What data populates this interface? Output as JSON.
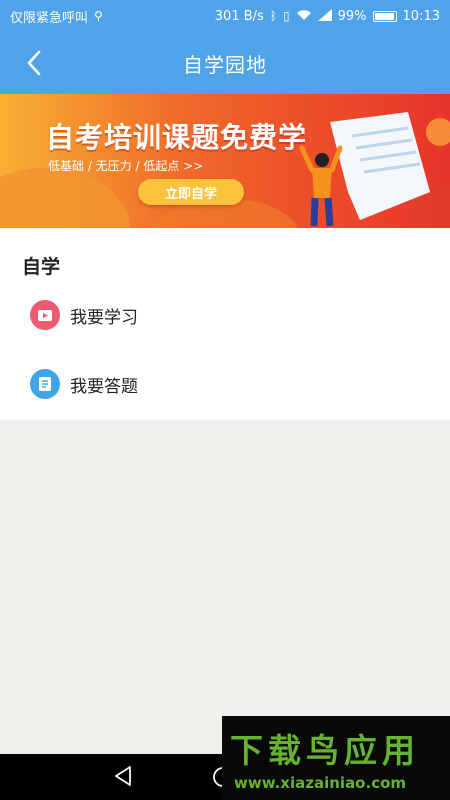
{
  "status_bar": {
    "left_text": "仅限紧急呼叫",
    "usb_icon": "usb-icon",
    "speed": "301 B/s",
    "battery_percent": "99%",
    "time": "10:13"
  },
  "app_bar": {
    "title": "自学园地",
    "back_icon": "chevron-left-icon"
  },
  "banner": {
    "headline": "自考培训课题免费学",
    "subline": "低基础 / 无压力 / 低起点 >>",
    "cta_label": "立即自学"
  },
  "section": {
    "title": "自学",
    "items": [
      {
        "label": "我要学习",
        "icon": "video-play-icon",
        "color": "#ee5a6f"
      },
      {
        "label": "我要答题",
        "icon": "answer-sheet-icon",
        "color": "#3ea6e6"
      }
    ]
  },
  "watermark": {
    "title": "下载鸟应用",
    "url": "www.xiazainiao.com"
  },
  "colors": {
    "app_bar": "#4fa3e8",
    "page_bg": "#f0efeb",
    "watermark_green": "#65b32e"
  }
}
